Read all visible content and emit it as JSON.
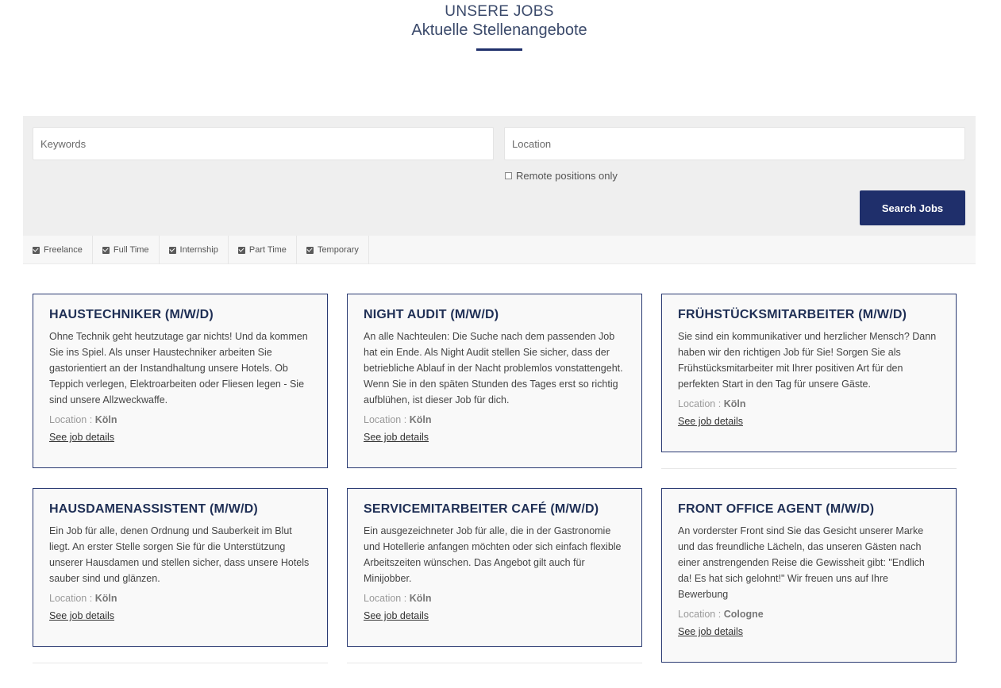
{
  "header": {
    "title": "UNSERE JOBS",
    "subtitle": "Aktuelle Stellenangebote"
  },
  "search": {
    "keywords_placeholder": "Keywords",
    "location_placeholder": "Location",
    "remote_label": "Remote positions only",
    "button_label": "Search Jobs"
  },
  "job_types": [
    "Freelance",
    "Full Time",
    "Internship",
    "Part Time",
    "Temporary"
  ],
  "location_label": "Location :",
  "details_label": "See job details",
  "jobs": [
    {
      "title": "HAUSTECHNIKER (M/W/D)",
      "description": "Ohne Technik geht heutzutage gar nichts! Und da kommen Sie ins Spiel. Als unser Haustechniker arbeiten Sie gastorientiert an der Instandhaltung unsere Hotels. Ob Teppich verlegen, Elektroarbeiten oder Fliesen legen - Sie sind unsere Allzweckwaffe.",
      "location": "Köln"
    },
    {
      "title": "NIGHT AUDIT (M/W/D)",
      "description": "An alle Nachteulen: Die Suche nach dem passenden Job hat ein Ende. Als Night Audit stellen Sie sicher, dass der betriebliche Ablauf in der Nacht problemlos vonstattengeht.  Wenn Sie in den späten Stunden des Tages erst so richtig aufblühen, ist dieser Job für dich.",
      "location": "Köln"
    },
    {
      "title": "FRÜHSTÜCKSMITARBEITER (M/W/D)",
      "description": "Sie sind ein kommunikativer und herzlicher Mensch? Dann haben wir den richtigen Job für Sie! Sorgen Sie als Frühstücksmitarbeiter mit Ihrer positiven Art für den perfekten Start in den Tag für unsere Gäste.",
      "location": "Köln"
    },
    {
      "title": "HAUSDAMENASSISTENT (M/W/D)",
      "description": "Ein Job für alle, denen Ordnung und Sauberkeit im Blut liegt. An erster Stelle sorgen Sie für die Unterstützung unserer Hausdamen und stellen sicher, dass unsere Hotels sauber sind und glänzen.",
      "location": "Köln"
    },
    {
      "title": "SERVICEMITARBEITER CAFÉ (M/W/D)",
      "description": "Ein ausgezeichneter Job für alle, die in der Gastronomie und Hotellerie anfangen möchten oder sich einfach flexible Arbeitszeiten wünschen. Das Angebot gilt auch für Minijobber.",
      "location": "Köln"
    },
    {
      "title": "FRONT OFFICE AGENT (M/W/D)",
      "description": "An vorderster Front sind Sie das Gesicht unserer Marke und das freundliche Lächeln, das unseren Gästen nach einer anstrengenden Reise die Gewissheit gibt: \"Endlich da! Es hat sich gelohnt!\" Wir freuen uns auf Ihre Bewerbung",
      "location": "Cologne"
    }
  ]
}
